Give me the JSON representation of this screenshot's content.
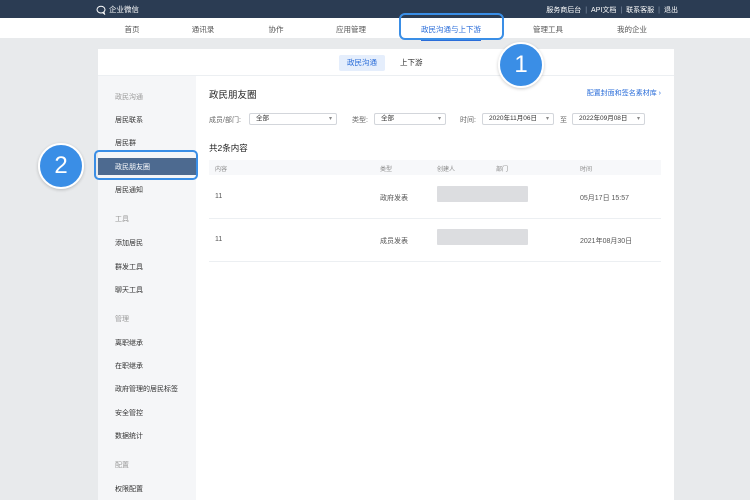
{
  "topbar": {
    "logo_text": "企业微信",
    "links": [
      "服务商后台",
      "API文档",
      "联系客服",
      "退出"
    ]
  },
  "nav": [
    "首页",
    "通讯录",
    "协作",
    "应用管理",
    "政民沟通与上下游",
    "管理工具",
    "我的企业"
  ],
  "subtabs": [
    "政民沟通",
    "上下游"
  ],
  "sidebar": {
    "g1": "政民沟通",
    "i1": "居民联系",
    "i2": "居民群",
    "i3": "政民朋友圈",
    "i4": "居民通知",
    "g2": "工具",
    "i5": "添加居民",
    "i6": "群发工具",
    "i7": "聊天工具",
    "g3": "管理",
    "i8": "离职继承",
    "i9": "在职继承",
    "i10": "政府管理的居民标签",
    "i11": "安全管控",
    "i12": "数据统计",
    "g4": "配置",
    "i13": "权限配置"
  },
  "content": {
    "title": "政民朋友圈",
    "config_link": "配置封面和签名素材库 ›"
  },
  "filters": {
    "member_label": "成员/部门:",
    "member_value": "全部",
    "type_label": "类型:",
    "type_value": "全部",
    "time_label": "时间:",
    "start_date": "2020年11月06日",
    "range_sep": "至",
    "end_date": "2022年09月08日"
  },
  "count_text": "共2条内容",
  "table": {
    "headers": [
      "内容",
      "类型",
      "创建人",
      "部门",
      "时间"
    ],
    "rows": [
      {
        "content": "11",
        "type": "政府发表",
        "time": "05月17日 15:57"
      },
      {
        "content": "11",
        "type": "成员发表",
        "time": "2021年08月30日"
      }
    ]
  },
  "badges": [
    "1",
    "2"
  ]
}
